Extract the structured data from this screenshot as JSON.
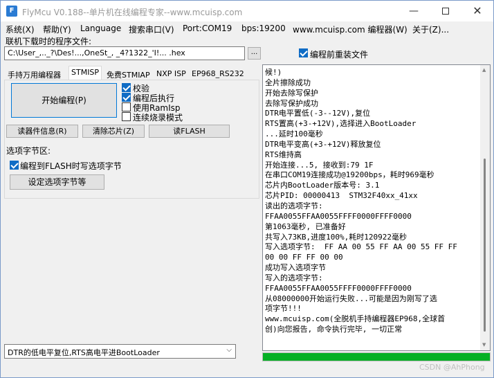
{
  "title": "FlyMcu V0.188--单片机在线编程专家--www.mcuisp.com",
  "window_controls": {
    "minimize": "—",
    "maximize": "",
    "close": "✕"
  },
  "menu": [
    "系统(X)",
    "帮助(Y)",
    "Language",
    "搜索串口(V)",
    "Port:COM19",
    "bps:19200",
    "www.mcuisp.com 编程器(W)",
    "关于(Z)..."
  ],
  "program_file": {
    "label": "联机下载时的程序文件:",
    "value": "C:\\User_,.._?\\Des!...,OneSt_, _4?1322_'I!... .hex",
    "browse": "...",
    "reload_label": "编程前重装文件",
    "reload_checked": true
  },
  "tabs": [
    "手持万用编程器",
    "STMISP",
    "免费STMIAP",
    "NXP ISP",
    "EP968_RS232"
  ],
  "active_tab": 1,
  "stmisp": {
    "start_button": "开始编程(P)",
    "options": [
      {
        "label": "校验",
        "checked": true
      },
      {
        "label": "编程后执行",
        "checked": true
      },
      {
        "label": "使用RamIsp",
        "checked": false
      },
      {
        "label": "连续烧录模式",
        "checked": false
      }
    ],
    "read_device_button": "读器件信息(R)",
    "erase_button": "清除芯片(Z)",
    "read_flash_button": "读FLASH",
    "option_bytes_title": "选项字节区:",
    "write_option_label": "编程到FLASH时写选项字节",
    "write_option_checked": true,
    "set_option_button": "设定选项字节等"
  },
  "boot_mode": {
    "value": "DTR的低电平复位,RTS高电平进BootLoader",
    "arrow": "⌵"
  },
  "log_lines": [
    "候!)",
    "全片擦除成功",
    "开始去除写保护",
    "去除写保护成功",
    "DTR电平置低(-3--12V),复位",
    "RTS置高(+3-+12V),选择进入BootLoader",
    "...延时100毫秒",
    "DTR电平变高(+3-+12V)释放复位",
    "RTS维持高",
    "开始连接...5, 接收到:79 1F",
    "在串口COM19连接成功@19200bps，耗时969毫秒",
    "芯片内BootLoader版本号: 3.1",
    "芯片PID: 00000413  STM32F40xx_41xx",
    "读出的选项字节:",
    "FFAA0055FFAA0055FFFF0000FFFF0000",
    "第1063毫秒, 已准备好",
    "共写入73KB,进度100%,耗时120922毫秒",
    "写入选项字节:  FF AA 00 55 FF AA 00 55 FF FF",
    "00 00 FF FF 00 00",
    "成功写入选项字节",
    "写入的选项字节:",
    "FFAA0055FFAA0055FFFF0000FFFF0000",
    "从08000000开始运行失败...可能是因为刚写了选",
    "项字节!!!",
    "www.mcuisp.com(全脱机手持编程器EP968,全球首",
    "创)向您报告, 命令执行完毕, 一切正常"
  ],
  "progress_fraction": 1.0,
  "progress_color": "#06b025",
  "watermark": "CSDN @AhPhong"
}
